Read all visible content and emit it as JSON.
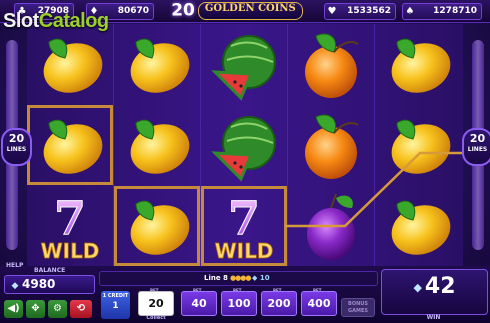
{
  "watermark": {
    "text_a": "Slot",
    "text_b": "Catalog"
  },
  "title": {
    "number": "20",
    "text": "GOLDEN COINS"
  },
  "jackpots": [
    {
      "suit": "♣",
      "value": "27908"
    },
    {
      "suit": "♦",
      "value": "80670"
    },
    {
      "suit": "♥",
      "value": "1533562"
    },
    {
      "suit": "♠",
      "value": "1278710"
    }
  ],
  "lines": {
    "number": "20",
    "label": "LINES"
  },
  "reels": [
    [
      "lemon",
      "lemon",
      "seven-wild"
    ],
    [
      "lemon",
      "lemon",
      "lemon"
    ],
    [
      "watermelon",
      "watermelon",
      "seven-wild"
    ],
    [
      "orange",
      "orange",
      "plum"
    ],
    [
      "lemon",
      "lemon",
      "lemon"
    ]
  ],
  "winning_cells": [
    [
      0,
      1
    ],
    [
      1,
      2
    ],
    [
      2,
      2
    ]
  ],
  "bottom": {
    "help_label": "HELP",
    "balance_label": "BALANCE",
    "balance": "4980",
    "line_info": "Line 8",
    "line_gem_value": "10",
    "credit_label": "1 CREDIT",
    "credit_value": "1",
    "bet_label": "BET",
    "bets": [
      "20",
      "40",
      "100",
      "200",
      "400"
    ],
    "collect_label": "Collect",
    "bonus_label": "BONUS GAMES",
    "win_amount": "42",
    "win_label": "WIN"
  },
  "colors": {
    "background": "#22105a",
    "win_frame": "#c58a3a",
    "payline": "#d69a3a",
    "accent": "#7c4fe0"
  }
}
